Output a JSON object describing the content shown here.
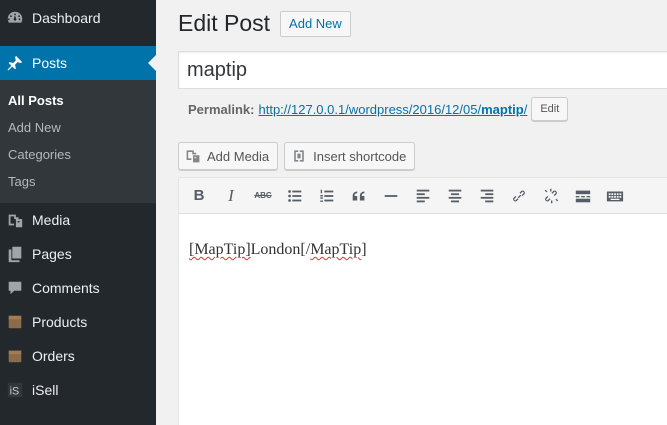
{
  "sidebar": {
    "items": [
      {
        "label": "Dashboard",
        "icon": "dashboard-icon"
      },
      {
        "label": "Posts",
        "icon": "pushpin-icon",
        "current": true
      },
      {
        "label": "Media",
        "icon": "media-icon"
      },
      {
        "label": "Pages",
        "icon": "pages-icon"
      },
      {
        "label": "Comments",
        "icon": "comments-icon"
      },
      {
        "label": "Products",
        "icon": "products-icon"
      },
      {
        "label": "Orders",
        "icon": "orders-icon"
      },
      {
        "label": "iSell",
        "icon": "isell-icon"
      }
    ],
    "submenu": [
      "All Posts",
      "Add New",
      "Categories",
      "Tags"
    ],
    "colors": {
      "bg": "#23282d",
      "submenu_bg": "#32373c",
      "accent": "#0073aa"
    }
  },
  "header": {
    "title": "Edit Post",
    "add_new": "Add New"
  },
  "post": {
    "title": "maptip",
    "permalink_label": "Permalink:",
    "permalink_base": "http://127.0.0.1/wordpress/2016/12/05/",
    "permalink_slug": "maptip",
    "permalink_tail": "/",
    "edit_label": "Edit"
  },
  "media": {
    "add_media": "Add Media",
    "insert_shortcode": "Insert shortcode"
  },
  "toolbar": {
    "buttons": [
      "bold",
      "italic",
      "strikethrough",
      "bullet-list",
      "numbered-list",
      "blockquote",
      "horizontal-rule",
      "align-left",
      "align-center",
      "align-right",
      "insert-link",
      "remove-link",
      "read-more",
      "toolbar-toggle"
    ],
    "bold_glyph": "B",
    "italic_glyph": "I",
    "strike_glyph": "ABC"
  },
  "content": {
    "open_tag": "[MapTip]",
    "body": "London",
    "close_prefix": "[/",
    "close_tag": "MapTip",
    "close_suffix": "]"
  }
}
